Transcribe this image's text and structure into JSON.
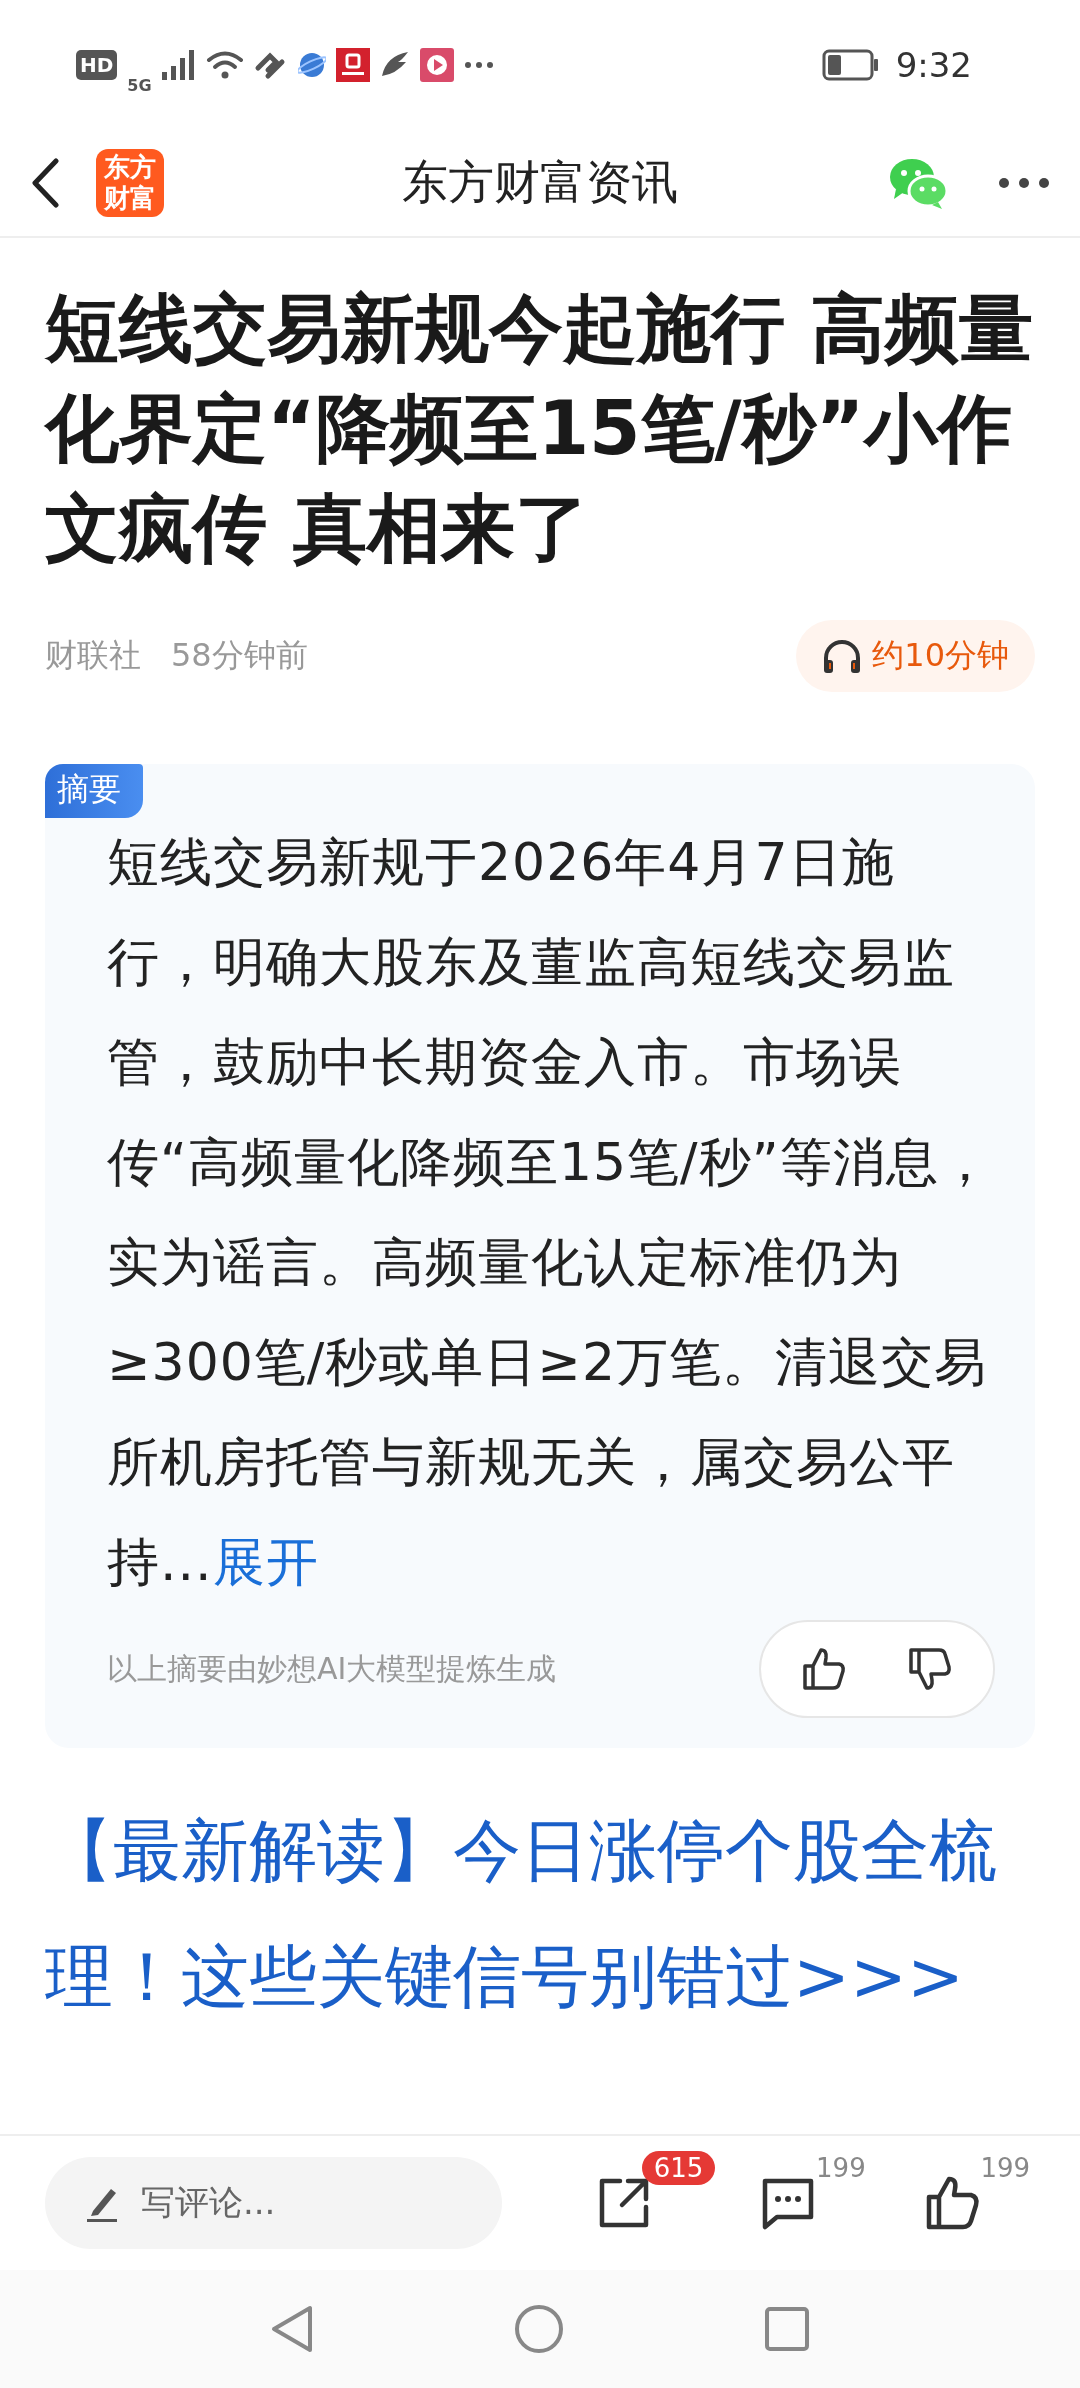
{
  "status_bar": {
    "time": "9:32",
    "network": "5G",
    "hd": "HD"
  },
  "header": {
    "logo": "东方财富",
    "title": "东方财富资讯"
  },
  "article": {
    "title": "短线交易新规今起施行 高频量化界定“降频至15笔/秒”小作文疯传 真相来了",
    "source": "财联社",
    "time": "58分钟前",
    "listen": "约10分钟"
  },
  "summary": {
    "badge": "摘要",
    "text": "短线交易新规于2026年4月7日施行，明确大股东及董监高短线交易监管，鼓励中长期资金入市。市场误传“高频量化降频至15笔/秒”等消息，实为谣言。高频量化认定标准仍为≥300笔/秒或单日≥2万笔。清退交易所机房托管与新规无关，属交易公平持...",
    "expand": "展开",
    "note": "以上摘要由妙想AI大模型提炼生成"
  },
  "promo_link": "【最新解读】今日涨停个股全梳理！这些关键信号别错过>>>",
  "bottom_bar": {
    "comment_placeholder": "写评论...",
    "share_count": "615",
    "comment_count": "199",
    "like_count": "199"
  }
}
